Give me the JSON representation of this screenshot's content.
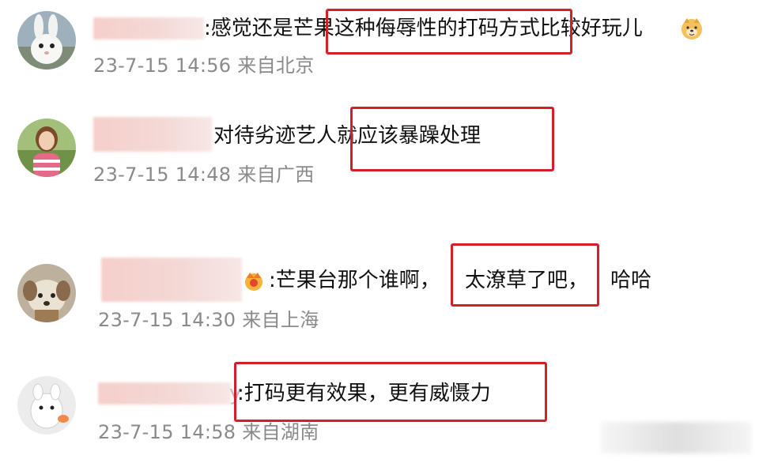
{
  "comments": [
    {
      "avatar": "white-rabbit-avatar",
      "text": ":感觉还是芒果这种侮辱性的打码方式比较好玩儿",
      "emoji": "doge-emoji",
      "meta": "23-7-15 14:56 来自北京"
    },
    {
      "avatar": "girl-avatar",
      "text": "对待劣迹艺人就应该暴躁处理",
      "meta": "23-7-15 14:48 来自广西"
    },
    {
      "avatar": "plush-dog-avatar",
      "badge": "crown-badge",
      "text_part1": ":芒果台那个谁啊，",
      "text_part2": "太潦草了吧，",
      "text_part3": "哈哈",
      "meta": "23-7-15 14:30 来自上海"
    },
    {
      "avatar": "white-cartoon-avatar",
      "name_tail": "y",
      "text": ":打码更有效果，更有威慑力",
      "meta": "23-7-15 14:58 来自湖南"
    }
  ],
  "colors": {
    "highlight": "#d51f28",
    "meta_text": "#8a8a8a",
    "body_text": "#111111",
    "name_blur": "#f6cfcb"
  }
}
